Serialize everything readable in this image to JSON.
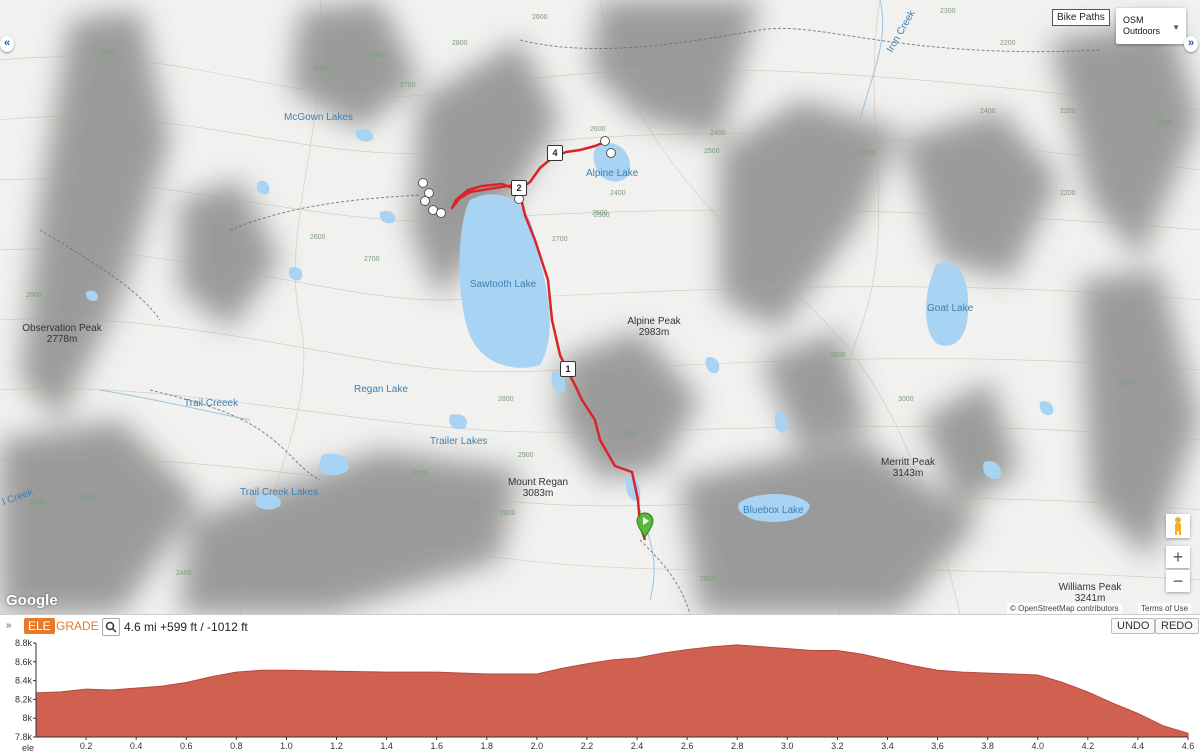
{
  "map": {
    "layer_button": "Bike Paths",
    "basemap": {
      "line1": "OSM",
      "line2": "Outdoors"
    },
    "zoom_in": "+",
    "zoom_out": "−",
    "google": "Google",
    "attribution": "© OpenStreetMap contributors",
    "terms": "Terms of Use",
    "left_toggle": "«",
    "right_toggle": "»",
    "lakes": {
      "mcgown": "McGown Lakes",
      "alpine": "Alpine Lake",
      "sawtooth": "Sawtooth Lake",
      "regan": "Regan Lake",
      "trailer": "Trailer Lakes",
      "trail_creek": "Trail Creek Lakes",
      "goat": "Goat Lake",
      "bluebox": "Bluebox Lake"
    },
    "creeks": {
      "trail_creek": "Trail Creeek",
      "iron_creek": "Iron Creek",
      "left_creek": "l Creek"
    },
    "peaks": {
      "observation": {
        "name": "Observation Peak",
        "elev": "2778m"
      },
      "alpine": {
        "name": "Alpine Peak",
        "elev": "2983m"
      },
      "regan": {
        "name": "Mount Regan",
        "elev": "3083m"
      },
      "merritt": {
        "name": "Merritt Peak",
        "elev": "3143m"
      },
      "williams": {
        "name": "Williams Peak",
        "elev": "3241m"
      }
    },
    "contour_labels": [
      "2700",
      "2500",
      "2600",
      "2400",
      "2800",
      "2600",
      "2300",
      "2200",
      "2400",
      "2500",
      "2600",
      "2700",
      "2900",
      "3000",
      "2800",
      "2500",
      "2400",
      "2300",
      "2700",
      "2600",
      "2800",
      "2500",
      "2400",
      "2300",
      "2200",
      "2100",
      "2000",
      "2600",
      "2700",
      "2800",
      "2900",
      "2400",
      "2200",
      "2100",
      "2500"
    ],
    "route_markers": [
      "1",
      "2",
      "4"
    ]
  },
  "profile": {
    "collapse": "»",
    "ele": "ELE",
    "grade": "GRADE",
    "zoom_icon": "magnifier-icon",
    "stats": "4.6 mi +599 ft / -1012 ft",
    "undo": "UNDO",
    "redo": "REDO",
    "y_ticks": [
      "8.8k",
      "8.6k",
      "8.4k",
      "8.2k",
      "8k",
      "7.8k"
    ],
    "x_ticks": [
      "0.2",
      "0.4",
      "0.6",
      "0.8",
      "1.0",
      "1.2",
      "1.4",
      "1.6",
      "1.8",
      "2.0",
      "2.2",
      "2.4",
      "2.6",
      "2.8",
      "3.0",
      "3.2",
      "3.4",
      "3.6",
      "3.8",
      "4.0",
      "4.2",
      "4.4",
      "4.6"
    ],
    "x_axis_label": "ele",
    "fill_color": "#d0604f",
    "ylim": [
      7800,
      8800
    ],
    "xlim": [
      0,
      4.6
    ],
    "elev_x": [
      0,
      0.1,
      0.2,
      0.3,
      0.4,
      0.5,
      0.6,
      0.7,
      0.8,
      0.9,
      1.0,
      1.2,
      1.4,
      1.6,
      1.8,
      2.0,
      2.1,
      2.2,
      2.3,
      2.4,
      2.5,
      2.6,
      2.7,
      2.8,
      2.9,
      3.0,
      3.1,
      3.2,
      3.3,
      3.4,
      3.5,
      3.6,
      3.7,
      3.8,
      3.9,
      4.0,
      4.1,
      4.2,
      4.3,
      4.4,
      4.5,
      4.6
    ],
    "elev_y": [
      8270,
      8280,
      8310,
      8300,
      8320,
      8340,
      8380,
      8440,
      8490,
      8510,
      8510,
      8500,
      8490,
      8490,
      8470,
      8470,
      8530,
      8580,
      8620,
      8640,
      8690,
      8730,
      8760,
      8780,
      8760,
      8740,
      8720,
      8720,
      8680,
      8620,
      8560,
      8510,
      8490,
      8480,
      8470,
      8460,
      8380,
      8280,
      8160,
      8050,
      7920,
      7840
    ]
  }
}
